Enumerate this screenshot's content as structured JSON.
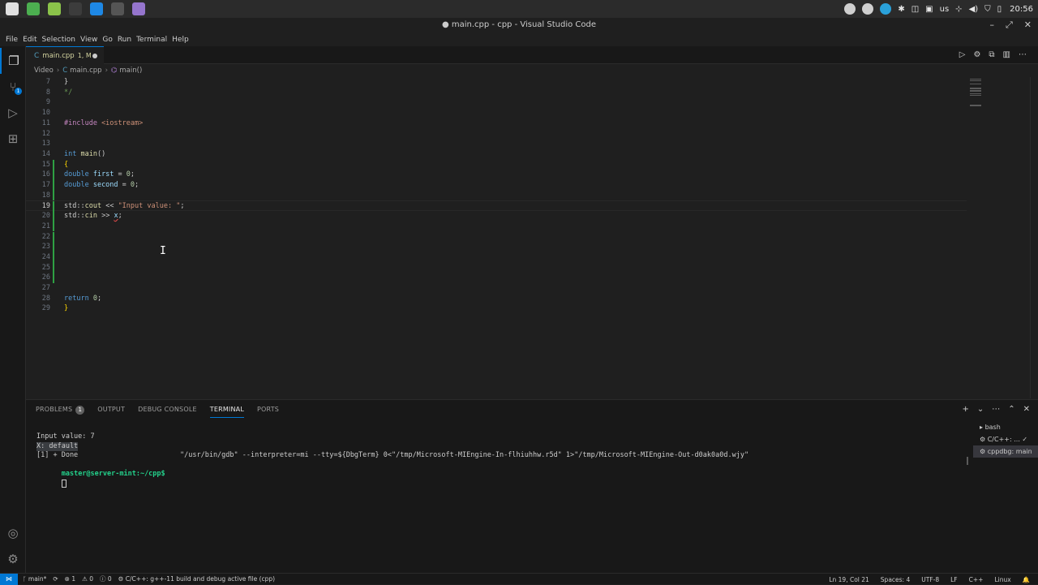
{
  "taskbar": {
    "apps": [
      {
        "name": "mint-menu-icon",
        "color": "#e0e0e0"
      },
      {
        "name": "chrome-icon",
        "color": "#4caf50"
      },
      {
        "name": "files-icon",
        "color": "#8bc34a"
      },
      {
        "name": "terminal-icon",
        "color": "#3c3c3c"
      },
      {
        "name": "vscode-icon",
        "color": "#1e88e5"
      },
      {
        "name": "obs-icon",
        "color": "#555555"
      },
      {
        "name": "notes-icon",
        "color": "#9575cd"
      }
    ],
    "keyboard_layout": "us",
    "clock": "20:56"
  },
  "window": {
    "title": "● main.cpp - cpp - Visual Studio Code",
    "controls": {
      "minimize": "–",
      "maximize": "⤢",
      "close": "✕"
    }
  },
  "menu": [
    "File",
    "Edit",
    "Selection",
    "View",
    "Go",
    "Run",
    "Terminal",
    "Help"
  ],
  "activity": {
    "explorer": "❐",
    "scm": "⑂",
    "scm_badge": "1",
    "run": "▷",
    "extensions": "⊞",
    "account": "◎",
    "settings": "⚙"
  },
  "tab": {
    "icon": "C",
    "filename": "main.cpp",
    "status": "1, M"
  },
  "editor_actions": {
    "run": "▷",
    "settings": "⚙",
    "split": "⧉",
    "layout": "▥",
    "more": "⋯"
  },
  "breadcrumb": {
    "folder": "Video",
    "file_icon": "C",
    "file": "main.cpp",
    "symbol_icon": "⌬",
    "symbol": "main()"
  },
  "code": {
    "current_line": "19",
    "lines": [
      {
        "n": "7",
        "text": "}"
      },
      {
        "n": "8",
        "text": "*/"
      },
      {
        "n": "9",
        "text": ""
      },
      {
        "n": "10",
        "text": ""
      },
      {
        "n": "11",
        "pp": "#include ",
        "inc": "<iostream>"
      },
      {
        "n": "12",
        "text": ""
      },
      {
        "n": "13",
        "text": ""
      },
      {
        "n": "14",
        "kw": "int ",
        "fn": "main",
        "rest": "()"
      },
      {
        "n": "15",
        "brace": "{"
      },
      {
        "n": "16",
        "kw": "double ",
        "var": "first",
        "rest": " = ",
        "num": "0",
        "end": ";"
      },
      {
        "n": "17",
        "kw": "double ",
        "var": "second",
        "rest": " = ",
        "num": "0",
        "end": ";"
      },
      {
        "n": "18",
        "text": ""
      },
      {
        "n": "19",
        "a": "std::",
        "fn": "cout",
        "b": " << ",
        "str": "\"Input value: \"",
        "end": ";"
      },
      {
        "n": "20",
        "a": "std::",
        "fn": "cin",
        "b": " >> ",
        "var": "x",
        "end": ";"
      },
      {
        "n": "21",
        "text": ""
      },
      {
        "n": "22",
        "text": ""
      },
      {
        "n": "23",
        "text": ""
      },
      {
        "n": "24",
        "text": ""
      },
      {
        "n": "25",
        "text": ""
      },
      {
        "n": "26",
        "text": ""
      },
      {
        "n": "27",
        "text": ""
      },
      {
        "n": "28",
        "kw": "return ",
        "num": "0",
        "end": ";"
      },
      {
        "n": "29",
        "brace": "}"
      }
    ]
  },
  "panel": {
    "tabs": [
      "PROBLEMS",
      "OUTPUT",
      "DEBUG CONSOLE",
      "TERMINAL",
      "PORTS"
    ],
    "problems_count": "1",
    "active_tab": "TERMINAL",
    "actions": {
      "new": "+",
      "dropdown": "⌄",
      "more": "⋯",
      "maximize": "⌃",
      "close": "✕"
    },
    "terminal_lines": {
      "l1": "Input value: 7",
      "l2": "X: default",
      "l3a": "[1] + Done",
      "l3b": "\"/usr/bin/gdb\" --interpreter=mi --tty=${DbgTerm} 0<\"/tmp/Microsoft-MIEngine-In-flhiuhhw.r5d\" 1>\"/tmp/Microsoft-MIEngine-Out-d0ak0a0d.wjy\"",
      "prompt": "master@server-mint:~/cpp$"
    },
    "terminals": [
      {
        "icon": "▸",
        "label": "bash"
      },
      {
        "icon": "⚙",
        "label": "C/C++: ... ✓"
      },
      {
        "icon": "⚙",
        "label": "cppdbg: main"
      }
    ]
  },
  "status": {
    "remote": "⋈",
    "branch": "ᚴ main*",
    "sync": "⟳",
    "errors": "⊗ 1",
    "warnings": "⚠ 0",
    "infos": "ⓘ 0",
    "task": "⚙ C/C++: g++-11 build and debug active file (cpp)",
    "position": "Ln 19, Col 21",
    "spaces": "Spaces: 4",
    "encoding": "UTF-8",
    "eol": "LF",
    "language": "C++",
    "os": "Linux",
    "bell": "🔔"
  }
}
